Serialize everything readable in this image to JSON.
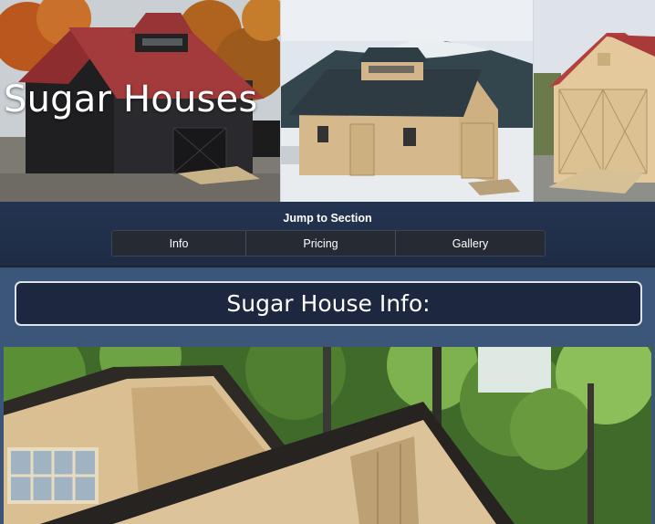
{
  "hero": {
    "title": "Sugar Houses",
    "photos": [
      "black-sugar-house-photo",
      "mountain-sugar-house-photo",
      "natural-sugar-house-photo"
    ]
  },
  "jump": {
    "title": "Jump to Section",
    "buttons": [
      {
        "label": "Info"
      },
      {
        "label": "Pricing"
      },
      {
        "label": "Gallery"
      }
    ]
  },
  "section": {
    "heading": "Sugar House Info:"
  },
  "colors": {
    "page_bg": "#3a5478",
    "nav_bg": "#1e2c45",
    "button_bg": "#262b33",
    "heading_bg": "#1d2740",
    "text": "#ffffff"
  }
}
